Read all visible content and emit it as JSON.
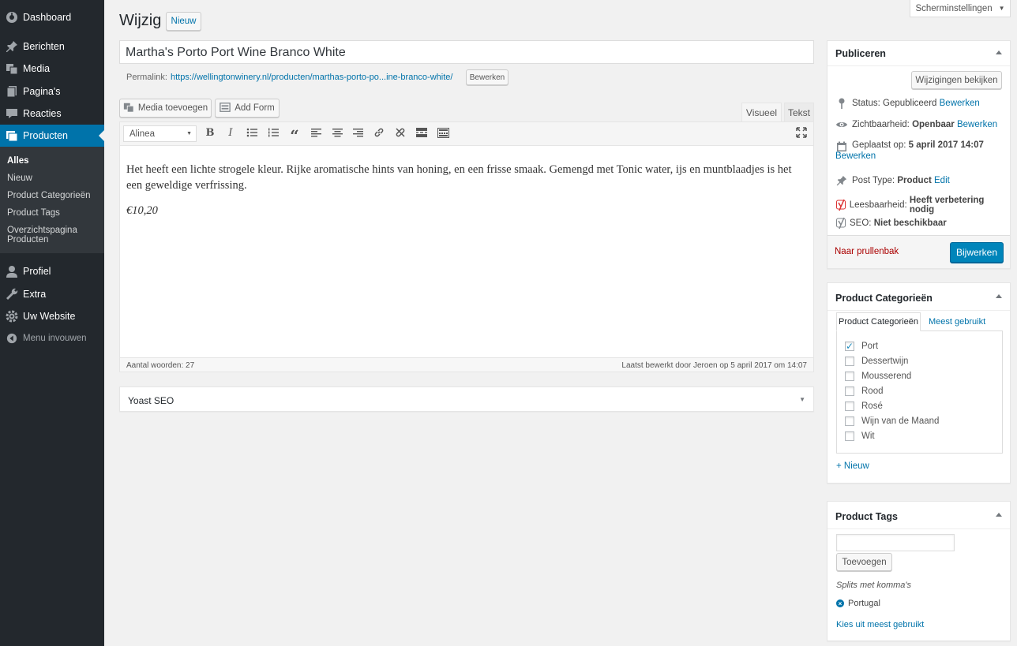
{
  "sidebar": {
    "items": [
      {
        "label": "Dashboard",
        "icon": "dashboard-icon"
      },
      {
        "label": "Berichten",
        "icon": "pin-icon"
      },
      {
        "label": "Media",
        "icon": "media-icon"
      },
      {
        "label": "Pagina's",
        "icon": "pages-icon"
      },
      {
        "label": "Reacties",
        "icon": "comments-icon"
      },
      {
        "label": "Producten",
        "icon": "products-icon"
      },
      {
        "label": "Profiel",
        "icon": "user-icon"
      },
      {
        "label": "Extra",
        "icon": "wrench-icon"
      },
      {
        "label": "Uw Website",
        "icon": "settings-icon"
      },
      {
        "label": "Menu invouwen",
        "icon": "collapse-icon"
      }
    ],
    "submenu": [
      "Alles",
      "Nieuw",
      "Product Categorieën",
      "Product Tags",
      "Overzichtspagina Producten"
    ]
  },
  "header": {
    "title": "Wijzig",
    "new_button": "Nieuw",
    "screen_options": "Scherminstellingen"
  },
  "post": {
    "title": "Martha's Porto Port Wine Branco White",
    "permalink_label": "Permalink:",
    "permalink_url": "https://wellingtonwinery.nl/producten/marthas-porto-po...ine-branco-white/",
    "permalink_edit": "Bewerken"
  },
  "editor": {
    "media_button": "Media toevoegen",
    "form_button": "Add Form",
    "tab_visual": "Visueel",
    "tab_text": "Tekst",
    "format_select": "Alinea",
    "content_paragraph": "Het heeft een lichte strogele kleur. Rijke aromatische hints van honing, en een frisse smaak. Gemengd met Tonic water, ijs en muntblaadjes is het een geweldige verfrissing.",
    "content_price": "€10,20",
    "word_count": "Aantal woorden: 27",
    "last_edited": "Laatst bewerkt door Jeroen op 5 april 2017 om 14:07"
  },
  "yoast": {
    "title": "Yoast SEO"
  },
  "publish": {
    "title": "Publiceren",
    "preview_button": "Wijzigingen bekijken",
    "status_label": "Status:",
    "status_value": "Gepubliceerd",
    "status_edit": "Bewerken",
    "visibility_label": "Zichtbaarheid:",
    "visibility_value": "Openbaar",
    "visibility_edit": "Bewerken",
    "date_label": "Geplaatst op:",
    "date_value": "5 april 2017 14:07",
    "date_edit": "Bewerken",
    "posttype_label": "Post Type:",
    "posttype_value": "Product",
    "posttype_edit": "Edit",
    "readability_label": "Leesbaarheid:",
    "readability_value": "Heeft verbetering nodig",
    "seo_label": "SEO:",
    "seo_value": "Niet beschikbaar",
    "trash_link": "Naar prullenbak",
    "update_button": "Bijwerken"
  },
  "categories": {
    "title": "Product Categorieën",
    "tab_all": "Product Categorieën",
    "tab_popular": "Meest gebruikt",
    "items": [
      {
        "label": "Port",
        "checked": true
      },
      {
        "label": "Dessertwijn",
        "checked": false
      },
      {
        "label": "Mousserend",
        "checked": false
      },
      {
        "label": "Rood",
        "checked": false
      },
      {
        "label": "Rosé",
        "checked": false
      },
      {
        "label": "Wijn van de Maand",
        "checked": false
      },
      {
        "label": "Wit",
        "checked": false
      }
    ],
    "add_new": "+ Nieuw"
  },
  "tags": {
    "title": "Product Tags",
    "input_value": "",
    "add_button": "Toevoegen",
    "hint": "Splits met komma's",
    "tag_list": [
      "Portugal"
    ],
    "popular_link": "Kies uit meest gebruikt"
  },
  "colors": {
    "sidebar_bg": "#23282d",
    "accent": "#0073aa",
    "primary_button": "#0085ba",
    "readability_red": "#dc3232"
  }
}
